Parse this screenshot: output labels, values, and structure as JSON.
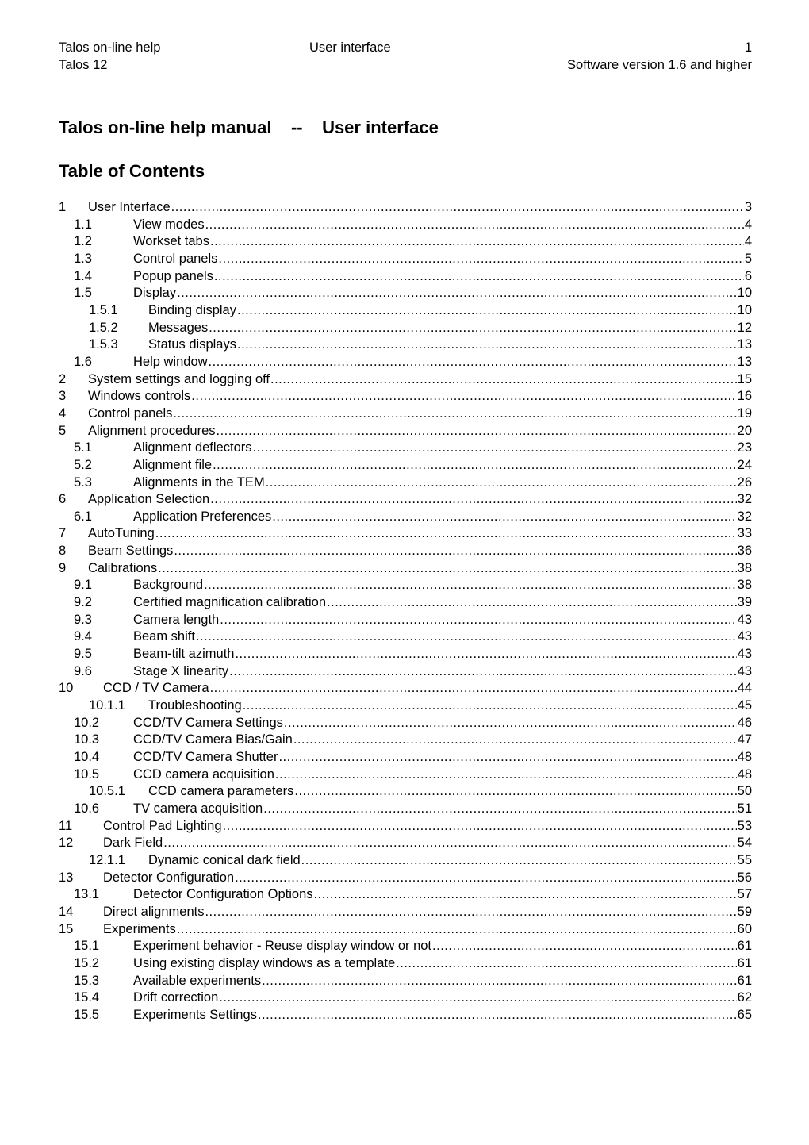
{
  "header": {
    "left_line1": "Talos on-line help",
    "center_line1": "User interface",
    "right_line1": "1",
    "left_line2": "Talos 12",
    "right_line2": "Software version 1.6 and higher"
  },
  "document_title": "Talos on-line help manual    --    User interface",
  "toc_title": "Table of Contents",
  "toc": [
    {
      "num": "1",
      "text": "User Interface",
      "page": "3",
      "level": 1
    },
    {
      "num": "1.1",
      "text": "View modes",
      "page": "4",
      "level": 2
    },
    {
      "num": "1.2",
      "text": "Workset tabs",
      "page": "4",
      "level": 2
    },
    {
      "num": "1.3",
      "text": "Control panels",
      "page": "5",
      "level": 2
    },
    {
      "num": "1.4",
      "text": "Popup panels",
      "page": "6",
      "level": 2
    },
    {
      "num": "1.5",
      "text": "Display",
      "page": "10",
      "level": 2
    },
    {
      "num": "1.5.1",
      "text": "Binding display",
      "page": "10",
      "level": 3
    },
    {
      "num": "1.5.2",
      "text": "Messages",
      "page": "12",
      "level": 3
    },
    {
      "num": "1.5.3",
      "text": "Status displays",
      "page": "13",
      "level": 3
    },
    {
      "num": "1.6",
      "text": "Help window",
      "page": "13",
      "level": 2
    },
    {
      "num": "2",
      "text": "System settings and logging off",
      "page": "15",
      "level": 1
    },
    {
      "num": "3",
      "text": "Windows controls",
      "page": "16",
      "level": 1
    },
    {
      "num": "4",
      "text": "Control panels",
      "page": "19",
      "level": 1
    },
    {
      "num": "5",
      "text": "Alignment procedures",
      "page": "20",
      "level": 1
    },
    {
      "num": "5.1",
      "text": "Alignment deflectors",
      "page": "23",
      "level": 2
    },
    {
      "num": "5.2",
      "text": "Alignment file",
      "page": "24",
      "level": 2
    },
    {
      "num": "5.3",
      "text": "Alignments in the TEM",
      "page": "26",
      "level": 2
    },
    {
      "num": "6",
      "text": "Application Selection",
      "page": "32",
      "level": 1
    },
    {
      "num": "6.1",
      "text": "Application Preferences",
      "page": "32",
      "level": 2
    },
    {
      "num": "7",
      "text": "AutoTuning",
      "page": "33",
      "level": 1
    },
    {
      "num": "8",
      "text": "Beam Settings",
      "page": "36",
      "level": 1
    },
    {
      "num": "9",
      "text": "Calibrations",
      "page": "38",
      "level": 1
    },
    {
      "num": "9.1",
      "text": "Background",
      "page": "38",
      "level": 2
    },
    {
      "num": "9.2",
      "text": "Certified magnification calibration",
      "page": "39",
      "level": 2
    },
    {
      "num": "9.3",
      "text": "Camera length",
      "page": "43",
      "level": 2
    },
    {
      "num": "9.4",
      "text": "Beam shift",
      "page": "43",
      "level": 2
    },
    {
      "num": "9.5",
      "text": "Beam-tilt azimuth",
      "page": "43",
      "level": 2
    },
    {
      "num": "9.6",
      "text": "Stage X linearity",
      "page": "43",
      "level": 2
    },
    {
      "num": "10",
      "text": "CCD / TV Camera",
      "page": "44",
      "level": 1
    },
    {
      "num": "10.1.1",
      "text": "Troubleshooting",
      "page": "45",
      "level": 3
    },
    {
      "num": "10.2",
      "text": "CCD/TV Camera Settings",
      "page": "46",
      "level": 2
    },
    {
      "num": "10.3",
      "text": "CCD/TV Camera Bias/Gain",
      "page": "47",
      "level": 2
    },
    {
      "num": "10.4",
      "text": "CCD/TV Camera Shutter",
      "page": "48",
      "level": 2
    },
    {
      "num": "10.5",
      "text": "CCD camera acquisition",
      "page": "48",
      "level": 2
    },
    {
      "num": "10.5.1",
      "text": "CCD camera parameters",
      "page": "50",
      "level": 3
    },
    {
      "num": "10.6",
      "text": "TV camera acquisition",
      "page": "51",
      "level": 2
    },
    {
      "num": "11",
      "text": "Control Pad Lighting",
      "page": "53",
      "level": 1
    },
    {
      "num": "12",
      "text": "Dark Field",
      "page": "54",
      "level": 1
    },
    {
      "num": "12.1.1",
      "text": "Dynamic conical dark field",
      "page": "55",
      "level": 3
    },
    {
      "num": "13",
      "text": "Detector Configuration",
      "page": "56",
      "level": 1
    },
    {
      "num": "13.1",
      "text": "Detector Configuration Options",
      "page": "57",
      "level": 2
    },
    {
      "num": "14",
      "text": "Direct alignments",
      "page": "59",
      "level": 1
    },
    {
      "num": "15",
      "text": "Experiments",
      "page": "60",
      "level": 1
    },
    {
      "num": "15.1",
      "text": "Experiment behavior - Reuse display window or not",
      "page": "61",
      "level": 2
    },
    {
      "num": "15.2",
      "text": "Using existing display windows as a template",
      "page": "61",
      "level": 2
    },
    {
      "num": "15.3",
      "text": "Available experiments",
      "page": "61",
      "level": 2
    },
    {
      "num": "15.4",
      "text": "Drift correction",
      "page": "62",
      "level": 2
    },
    {
      "num": "15.5",
      "text": "Experiments Settings",
      "page": "65",
      "level": 2
    }
  ]
}
